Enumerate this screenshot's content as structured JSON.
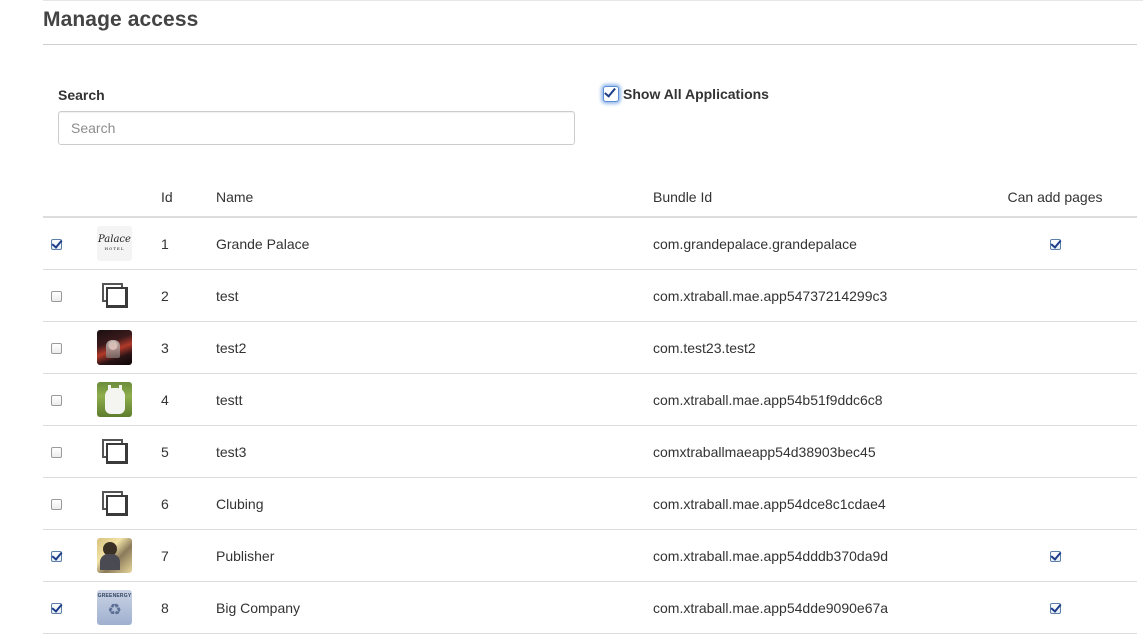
{
  "page": {
    "title": "Manage access"
  },
  "search": {
    "label": "Search",
    "placeholder": "Search",
    "value": ""
  },
  "show_all": {
    "label": "Show All Applications",
    "checked": true
  },
  "table": {
    "headers": {
      "select": "",
      "image": "",
      "id": "Id",
      "name": "Name",
      "bundle_id": "Bundle Id",
      "can_add_pages": "Can add pages"
    },
    "rows": [
      {
        "selected": true,
        "icon": "palace-hotel-logo-icon",
        "id": "1",
        "name": "Grande Palace",
        "bundle_id": "com.grandepalace.grandepalace",
        "can_add_pages": true
      },
      {
        "selected": false,
        "icon": "image-placeholder-icon",
        "id": "2",
        "name": "test",
        "bundle_id": "com.xtraball.mae.app54737214299c3",
        "can_add_pages": false
      },
      {
        "selected": false,
        "icon": "concert-photo-icon",
        "id": "3",
        "name": "test2",
        "bundle_id": "com.test23.test2",
        "can_add_pages": false
      },
      {
        "selected": false,
        "icon": "white-dog-photo-icon",
        "id": "4",
        "name": "testt",
        "bundle_id": "com.xtraball.mae.app54b51f9ddc6c8",
        "can_add_pages": false
      },
      {
        "selected": false,
        "icon": "image-placeholder-icon",
        "id": "5",
        "name": "test3",
        "bundle_id": "comxtraballmaeapp54d38903bec45",
        "can_add_pages": false
      },
      {
        "selected": false,
        "icon": "image-placeholder-icon",
        "id": "6",
        "name": "Clubing",
        "bundle_id": "com.xtraball.mae.app54dce8c1cdae4",
        "can_add_pages": false
      },
      {
        "selected": true,
        "icon": "publisher-photo-icon",
        "id": "7",
        "name": "Publisher",
        "bundle_id": "com.xtraball.mae.app54dddb370da9d",
        "can_add_pages": true
      },
      {
        "selected": true,
        "icon": "greenergy-logo-icon",
        "id": "8",
        "name": "Big Company",
        "bundle_id": "com.xtraball.mae.app54dde9090e67a",
        "can_add_pages": true
      }
    ]
  },
  "logos": {
    "palace": {
      "main": "Palace",
      "sub": "HOTEL"
    },
    "greenergy": {
      "main": "GREENERGY",
      "symbol": "♻"
    }
  },
  "colors": {
    "checkmark": "#1d3d8a",
    "focus_glow": "#528cdc",
    "row_border": "#dddddd",
    "title_text": "#444444"
  }
}
